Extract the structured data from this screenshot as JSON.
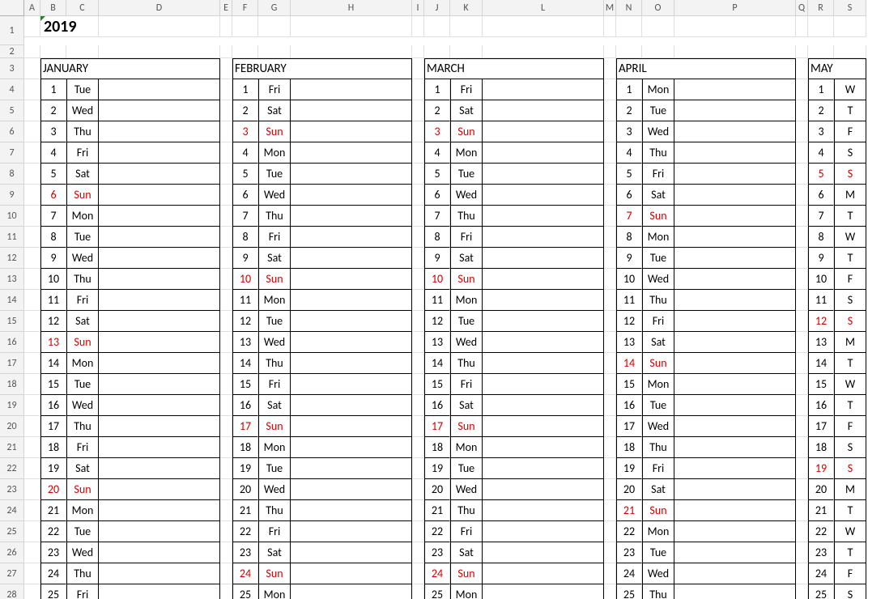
{
  "year": "2019",
  "columns": [
    "A",
    "B",
    "C",
    "D",
    "E",
    "F",
    "G",
    "H",
    "I",
    "J",
    "K",
    "L",
    "M",
    "N",
    "O",
    "P",
    "Q",
    "R",
    "S"
  ],
  "rows_visible": 28,
  "days_visible": 25,
  "months": [
    {
      "name": "JANUARY",
      "days": [
        "Tue",
        "Wed",
        "Thu",
        "Fri",
        "Sat",
        "Sun",
        "Mon",
        "Tue",
        "Wed",
        "Thu",
        "Fri",
        "Sat",
        "Sun",
        "Mon",
        "Tue",
        "Wed",
        "Thu",
        "Fri",
        "Sat",
        "Sun",
        "Mon",
        "Tue",
        "Wed",
        "Thu",
        "Fri"
      ]
    },
    {
      "name": "FEBRUARY",
      "days": [
        "Fri",
        "Sat",
        "Sun",
        "Mon",
        "Tue",
        "Wed",
        "Thu",
        "Fri",
        "Sat",
        "Sun",
        "Mon",
        "Tue",
        "Wed",
        "Thu",
        "Fri",
        "Sat",
        "Sun",
        "Mon",
        "Tue",
        "Wed",
        "Thu",
        "Fri",
        "Sat",
        "Sun",
        "Mon"
      ]
    },
    {
      "name": "MARCH",
      "days": [
        "Fri",
        "Sat",
        "Sun",
        "Mon",
        "Tue",
        "Wed",
        "Thu",
        "Fri",
        "Sat",
        "Sun",
        "Mon",
        "Tue",
        "Wed",
        "Thu",
        "Fri",
        "Sat",
        "Sun",
        "Mon",
        "Tue",
        "Wed",
        "Thu",
        "Fri",
        "Sat",
        "Sun",
        "Mon"
      ]
    },
    {
      "name": "APRIL",
      "days": [
        "Mon",
        "Tue",
        "Wed",
        "Thu",
        "Fri",
        "Sat",
        "Sun",
        "Mon",
        "Tue",
        "Wed",
        "Thu",
        "Fri",
        "Sat",
        "Sun",
        "Mon",
        "Tue",
        "Wed",
        "Thu",
        "Fri",
        "Sat",
        "Sun",
        "Mon",
        "Tue",
        "Wed",
        "Thu"
      ]
    },
    {
      "name": "MAY",
      "days": [
        "W",
        "T",
        "F",
        "S",
        "S",
        "M",
        "T",
        "W",
        "T",
        "F",
        "S",
        "S",
        "M",
        "T",
        "W",
        "T",
        "F",
        "S",
        "S",
        "M",
        "T",
        "W",
        "T",
        "F",
        "S"
      ],
      "partial": true
    }
  ]
}
